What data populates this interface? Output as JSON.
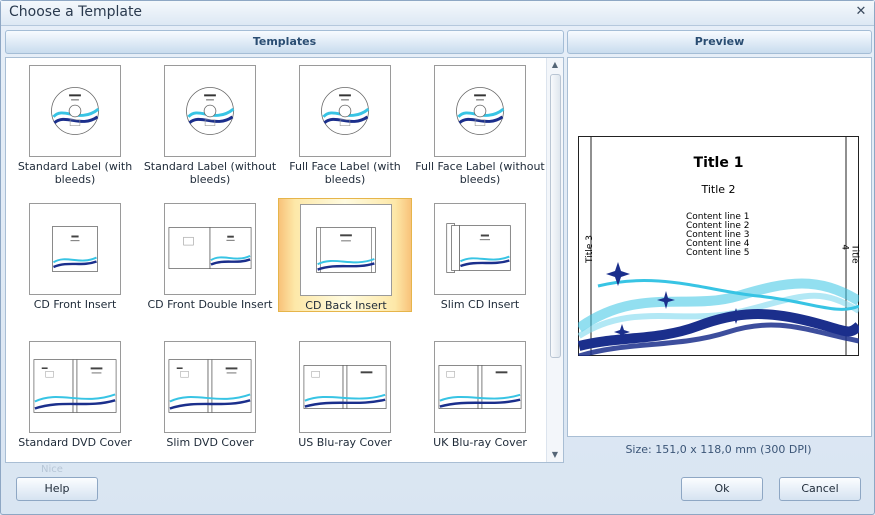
{
  "window": {
    "title": "Choose a Template",
    "close_glyph": "✕"
  },
  "templates_panel": {
    "header": "Templates",
    "items": [
      {
        "label": "Standard Label (with bleeds)",
        "kind": "disc",
        "selected": false
      },
      {
        "label": "Standard Label (without bleeds)",
        "kind": "disc",
        "selected": false
      },
      {
        "label": "Full Face Label (with bleeds)",
        "kind": "disc",
        "selected": false
      },
      {
        "label": "Full Face Label (without bleeds)",
        "kind": "disc",
        "selected": false
      },
      {
        "label": "CD Front Insert",
        "kind": "front",
        "selected": false
      },
      {
        "label": "CD Front Double Insert",
        "kind": "double",
        "selected": false
      },
      {
        "label": "CD Back Insert",
        "kind": "back",
        "selected": true
      },
      {
        "label": "Slim CD Insert",
        "kind": "slim",
        "selected": false
      },
      {
        "label": "Standard DVD Cover",
        "kind": "dvd",
        "selected": false
      },
      {
        "label": "Slim DVD Cover",
        "kind": "dvd",
        "selected": false
      },
      {
        "label": "US Blu-ray Cover",
        "kind": "bluray",
        "selected": false
      },
      {
        "label": "UK Blu-ray Cover",
        "kind": "bluray",
        "selected": false
      }
    ]
  },
  "preview_panel": {
    "header": "Preview",
    "title1": "Title 1",
    "title2": "Title 2",
    "content_lines": [
      "Content line 1",
      "Content line 2",
      "Content line 3",
      "Content line 4",
      "Content line 5"
    ],
    "side_left": "Title 3",
    "side_right": "Title 4"
  },
  "size_text": "Size: 151,0 x 118,0 mm (300 DPI)",
  "faint_text": "Nice",
  "buttons": {
    "help": "Help",
    "ok": "Ok",
    "cancel": "Cancel"
  },
  "colors": {
    "wave_dark": "#1b2f8c",
    "wave_light": "#38c4e4",
    "selection": "#fde8a8"
  }
}
